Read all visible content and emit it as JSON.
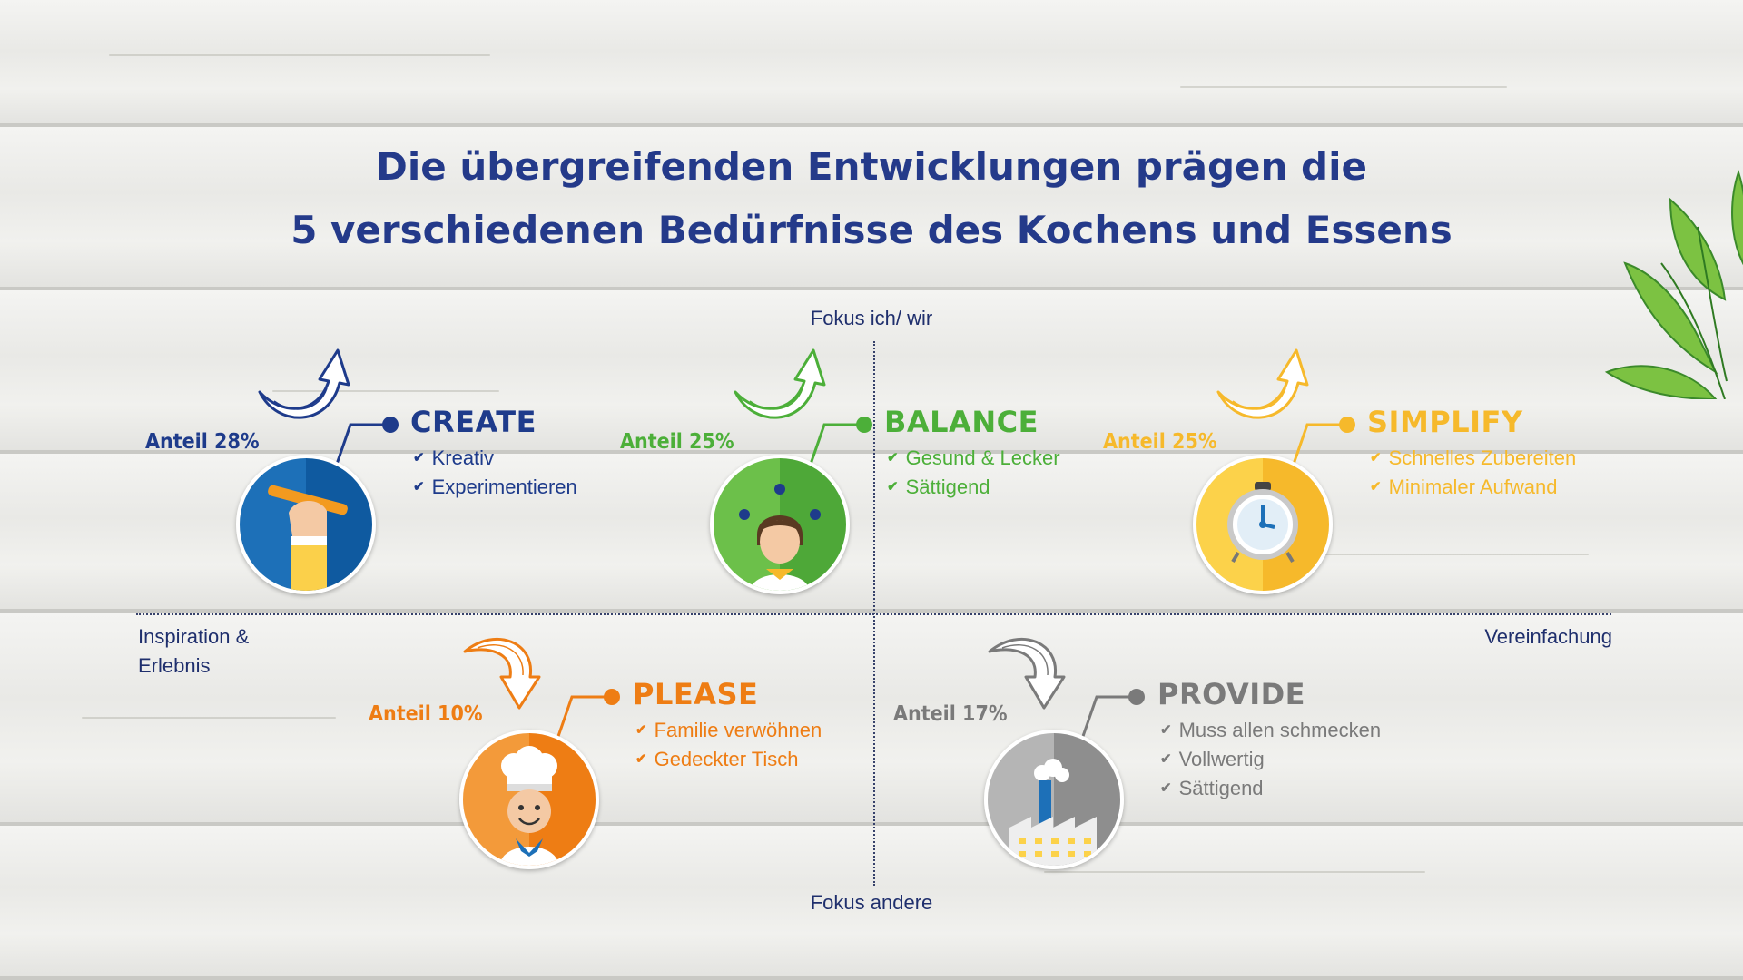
{
  "title": {
    "line1": "Die übergreifenden Entwicklungen prägen die",
    "line2": "5 verschiedenen Bedürfnisse des Kochens und Essens"
  },
  "axes": {
    "top": "Fokus ich/ wir",
    "bottom": "Fokus andere",
    "left_line1": "Inspiration &",
    "left_line2": "Erlebnis",
    "right": "Vereinfachung"
  },
  "quadrants": [
    {
      "key": "create",
      "title": "CREATE",
      "share": "Anteil 28%",
      "color": "#1e3b8b",
      "items": [
        "Kreativ",
        "Experimentieren"
      ],
      "icon": "hand-pencil-icon",
      "arrow": "trend-up-arrow-icon"
    },
    {
      "key": "balance",
      "title": "BALANCE",
      "share": "Anteil 25%",
      "color": "#4caf39",
      "items": [
        "Gesund & Lecker",
        "Sättigend"
      ],
      "icon": "person-juggling-icon",
      "arrow": "trend-up-arrow-icon"
    },
    {
      "key": "simplify",
      "title": "SIMPLIFY",
      "share": "Anteil 25%",
      "color": "#f6b92b",
      "items": [
        "Schnelles Zubereiten",
        "Minimaler Aufwand"
      ],
      "icon": "stopwatch-icon",
      "arrow": "trend-up-arrow-icon"
    },
    {
      "key": "please",
      "title": "PLEASE",
      "share": "Anteil 10%",
      "color": "#ee7d14",
      "items": [
        "Familie verwöhnen",
        "Gedeckter Tisch"
      ],
      "icon": "chef-icon",
      "arrow": "trend-down-arrow-icon"
    },
    {
      "key": "provide",
      "title": "PROVIDE",
      "share": "Anteil 17%",
      "color": "#7a7a7a",
      "items": [
        "Muss allen schmecken",
        "Vollwertig",
        "Sättigend"
      ],
      "icon": "factory-icon",
      "arrow": "trend-down-arrow-icon"
    }
  ]
}
